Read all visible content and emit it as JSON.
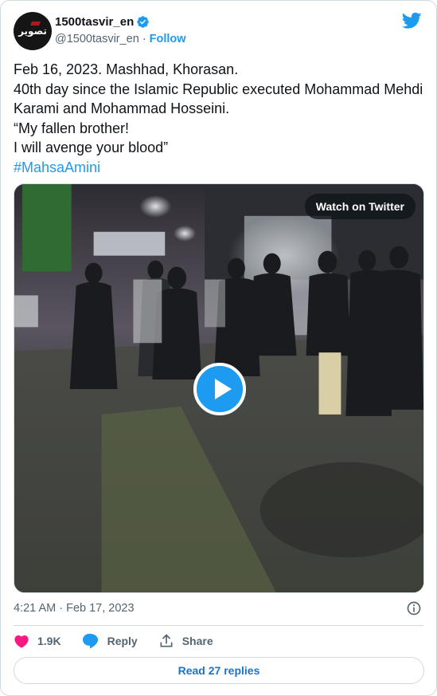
{
  "author": {
    "avatar_text": "تصویر",
    "display_name": "1500tasvir_en",
    "handle": "@1500tasvir_en",
    "separator": "·",
    "follow_label": "Follow"
  },
  "tweet": {
    "text": "Feb 16, 2023. Mashhad, Khorasan.\n40th day since the Islamic Republic executed Mohammad Mehdi Karami and Mohammad Hosseini.\n“My fallen brother!\nI will avenge your blood”",
    "hashtag": "#MahsaAmini",
    "timestamp": "4:21 AM · Feb 17, 2023"
  },
  "media": {
    "watch_label": "Watch on Twitter"
  },
  "actions": {
    "likes": "1.9K",
    "reply_label": "Reply",
    "share_label": "Share",
    "read_replies_label": "Read 27 replies"
  },
  "colors": {
    "accent": "#1d9bf0",
    "like": "#f91880",
    "text": "#0f1419",
    "muted": "#536471",
    "border": "#cfd9de"
  },
  "icons": [
    "verified-badge-icon",
    "twitter-bird-icon",
    "play-icon",
    "info-icon",
    "heart-icon",
    "reply-bubble-icon",
    "share-icon"
  ]
}
